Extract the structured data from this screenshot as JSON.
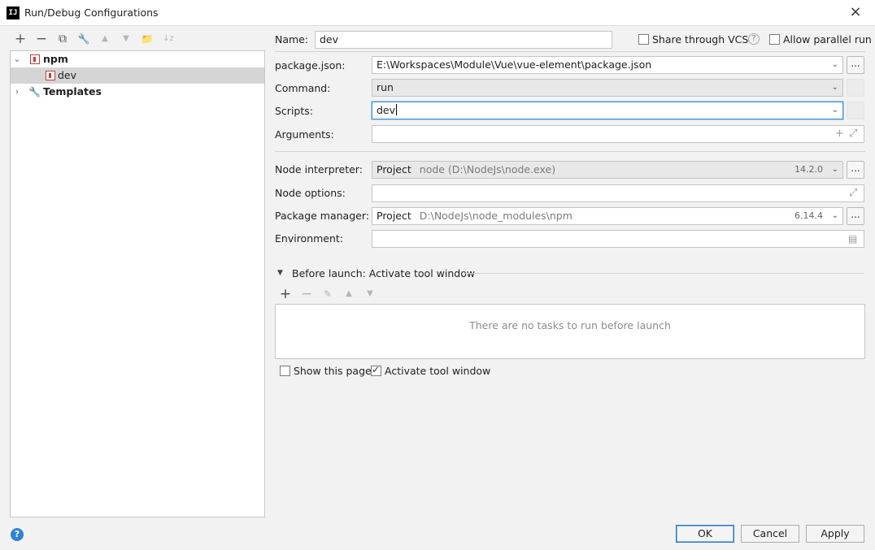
{
  "window": {
    "title": "Run/Debug Configurations",
    "close_icon": "×"
  },
  "toolbar": {
    "add": "+",
    "remove": "−",
    "copy": "⧉",
    "edit_defaults": "🔧",
    "move_up": "▲",
    "move_down": "▼",
    "folder": "📁",
    "sort": "↓z"
  },
  "tree": {
    "items": [
      {
        "label": "npm",
        "expanded": true
      },
      {
        "label": "dev",
        "selected": true
      },
      {
        "label": "Templates",
        "expanded": false
      }
    ]
  },
  "form": {
    "name_label": "Name:",
    "name_value": "dev",
    "share_label": "Share through VCS",
    "share_checked": false,
    "allow_parallel_label": "Allow parallel run",
    "allow_parallel_checked": false,
    "package_json_label": "package.json:",
    "package_json_value": "E:\\Workspaces\\Module\\Vue\\vue-element\\package.json",
    "command_label": "Command:",
    "command_value": "run",
    "scripts_label": "Scripts:",
    "scripts_value": "dev",
    "arguments_label": "Arguments:",
    "arguments_value": "",
    "node_interpreter_label": "Node interpreter:",
    "node_interpreter_project": "Project",
    "node_interpreter_path": "node (D:\\NodeJs\\node.exe)",
    "node_interpreter_version": "14.2.0",
    "node_options_label": "Node options:",
    "node_options_value": "",
    "package_manager_label": "Package manager:",
    "package_manager_project": "Project",
    "package_manager_path": "D:\\NodeJs\\node_modules\\npm",
    "package_manager_version": "6.14.4",
    "environment_label": "Environment:",
    "environment_value": "",
    "browse": "..."
  },
  "before_launch": {
    "title": "Before launch: Activate tool window",
    "empty_text": "There are no tasks to run before launch",
    "show_page_label": "Show this page",
    "show_page_checked": false,
    "activate_tool_label": "Activate tool window",
    "activate_tool_checked": true
  },
  "buttons": {
    "ok": "OK",
    "cancel": "Cancel",
    "apply": "Apply",
    "help": "?"
  }
}
